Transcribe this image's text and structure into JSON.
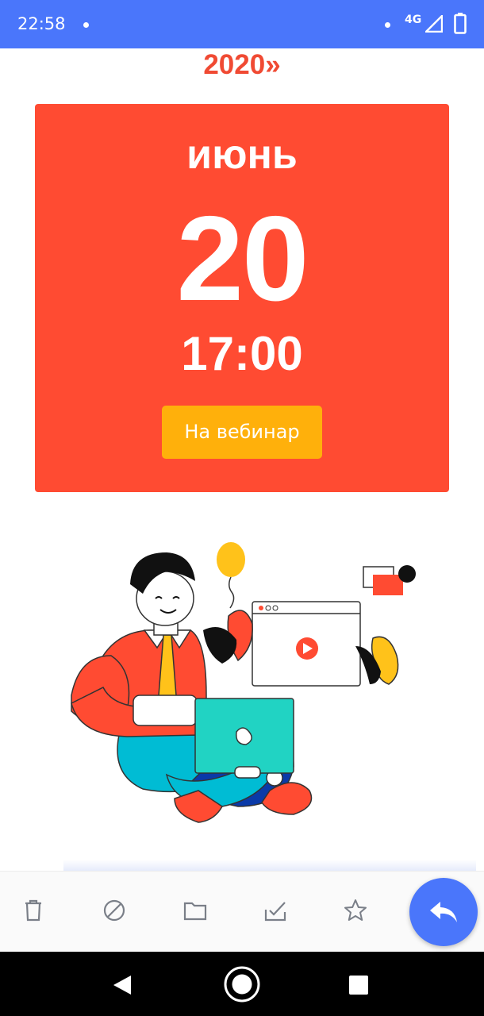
{
  "status_bar": {
    "time": "22:58",
    "network": "4G",
    "icons": [
      "notification-dot-icon",
      "signal-icon",
      "battery-icon"
    ]
  },
  "email_body": {
    "headline_fragment": "2020»",
    "event_card": {
      "month": "июнь",
      "day": "20",
      "time": "17:00",
      "button_label": "На вебинар",
      "background_color": "#ff4b32",
      "button_color": "#ffb00b"
    },
    "illustration": "person-with-laptop-illustration"
  },
  "toolbar": {
    "actions": [
      "delete-icon",
      "spam-icon",
      "move-to-folder-icon",
      "mark-done-icon",
      "star-icon"
    ],
    "reply_icon": "reply-icon",
    "accent_color": "#4a76fb"
  },
  "nav_bar": {
    "buttons": [
      "back-icon",
      "home-icon",
      "recents-icon"
    ]
  }
}
